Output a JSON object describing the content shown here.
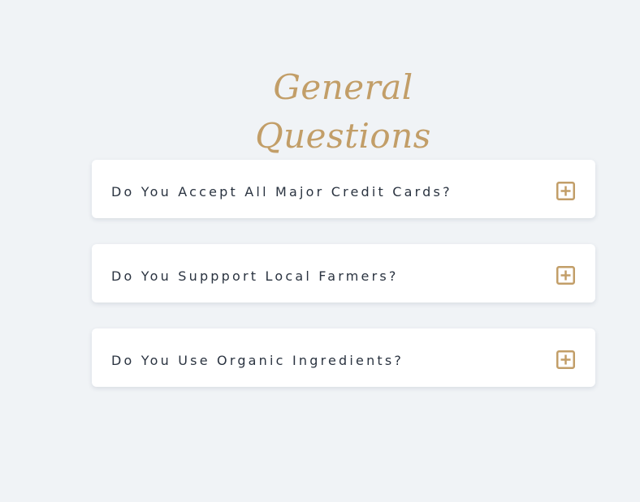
{
  "section": {
    "title": "General Questions"
  },
  "faq": {
    "items": [
      {
        "question": "Do You Accept All Major Credit Cards?",
        "icon": "plus-square-icon"
      },
      {
        "question": "Do You Suppport Local Farmers?",
        "icon": "plus-square-icon"
      },
      {
        "question": "Do You Use Organic Ingredients?",
        "icon": "plus-square-icon"
      }
    ]
  },
  "colors": {
    "background": "#f0f3f6",
    "accent": "#c29e68",
    "card": "#ffffff",
    "text": "#2a3340"
  }
}
